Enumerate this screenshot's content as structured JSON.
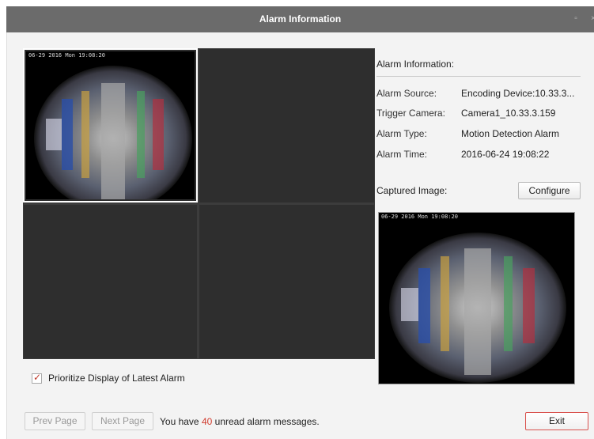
{
  "window": {
    "title": "Alarm Information"
  },
  "video": {
    "osd_text": "06-29 2016 Mon 19:08:20",
    "cells": [
      {
        "has_image": true
      },
      {
        "has_image": false
      },
      {
        "has_image": false
      },
      {
        "has_image": false
      }
    ]
  },
  "info": {
    "section_title": "Alarm Information:",
    "rows": [
      {
        "label": "Alarm Source:",
        "value": "Encoding Device:10.33.3..."
      },
      {
        "label": "Trigger Camera:",
        "value": "Camera1_10.33.3.159"
      },
      {
        "label": "Alarm Type:",
        "value": "Motion Detection Alarm"
      },
      {
        "label": "Alarm Time:",
        "value": "2016-06-24 19:08:22"
      }
    ],
    "captured_label": "Captured Image:",
    "configure_label": "Configure",
    "captured_osd_text": "06-29 2016 Mon 19:08:20"
  },
  "footer": {
    "prioritize_label": "Prioritize Display of Latest Alarm",
    "prioritize_checked": true,
    "prev_label": "Prev Page",
    "next_label": "Next Page",
    "unread_prefix": "You have",
    "unread_count": "40",
    "unread_suffix": "unread alarm messages.",
    "exit_label": "Exit"
  },
  "colors": {
    "titlebar": "#6b6b6b",
    "accent_red": "#d13b2e",
    "grid_cell": "#2e2e2e"
  }
}
